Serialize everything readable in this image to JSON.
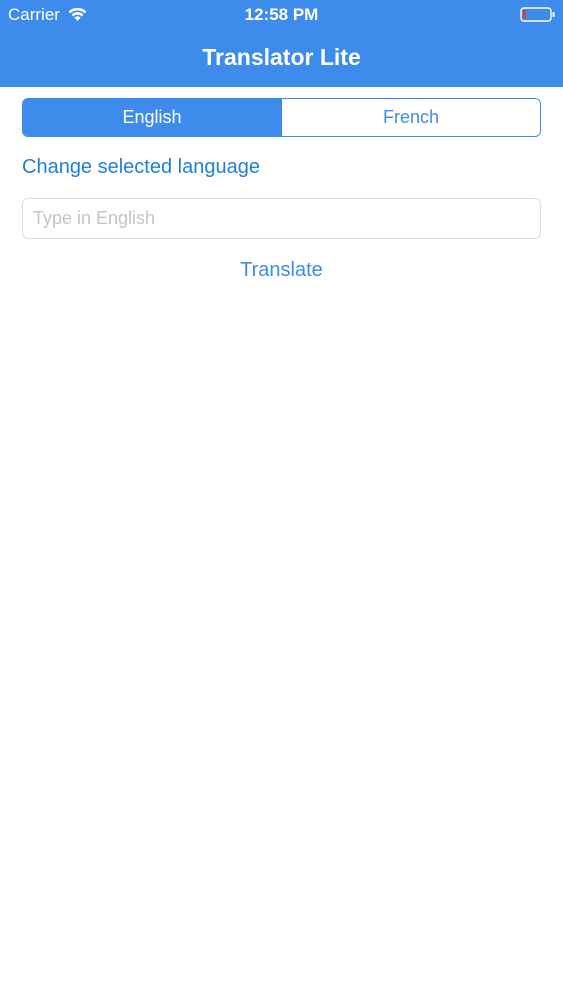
{
  "status_bar": {
    "carrier": "Carrier",
    "time": "12:58 PM",
    "wifi_icon": "wifi-icon",
    "battery_icon": "battery-low-icon"
  },
  "nav": {
    "title": "Translator Lite"
  },
  "language_selector": {
    "options": [
      "English",
      "French"
    ],
    "selected": "English"
  },
  "change_language_label": "Change selected language",
  "input": {
    "value": "",
    "placeholder": "Type in English"
  },
  "translate_label": "Translate",
  "colors": {
    "accent": "#3d8bea",
    "link": "#1f80d8",
    "battery_low": "#e0393e",
    "placeholder": "#c4c4c9"
  }
}
